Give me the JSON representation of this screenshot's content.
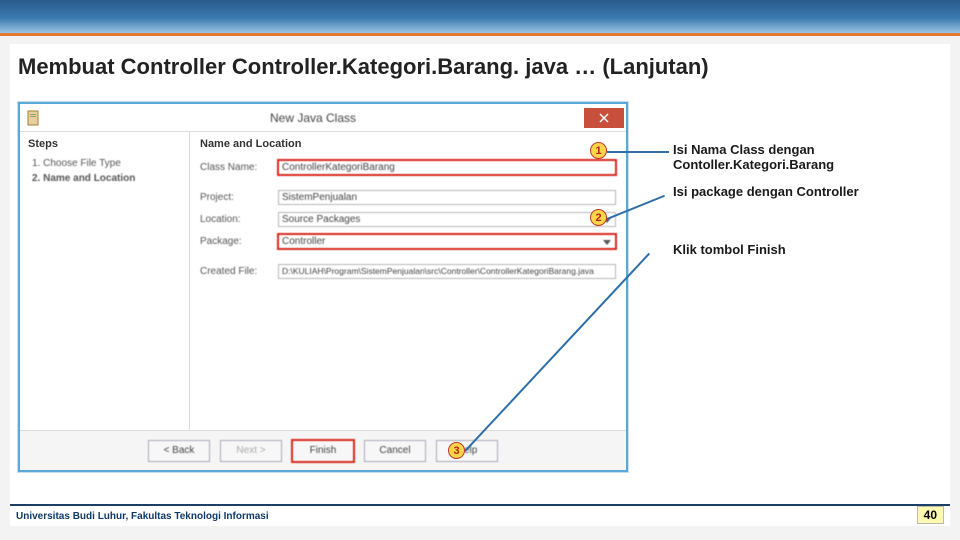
{
  "slide": {
    "title": "Membuat Controller Controller.Kategori.Barang. java … (Lanjutan)"
  },
  "dialog": {
    "title": "New Java Class",
    "steps_header": "Steps",
    "steps": [
      "1.  Choose File Type",
      "2.  Name and Location"
    ],
    "section": "Name and Location",
    "fields": {
      "class_name_label": "Class Name:",
      "class_name_value": "ControllerKategoriBarang",
      "project_label": "Project:",
      "project_value": "SistemPenjualan",
      "location_label": "Location:",
      "location_value": "Source Packages",
      "package_label": "Package:",
      "package_value": "Controller",
      "created_label": "Created File:",
      "created_value": "D:\\KULIAH\\Program\\SistemPenjualan\\src\\Controller\\ControllerKategoriBarang.java"
    },
    "buttons": {
      "back": "< Back",
      "next": "Next >",
      "finish": "Finish",
      "cancel": "Cancel",
      "help": "Help"
    }
  },
  "annotations": {
    "n1": "1",
    "n2": "2",
    "n3": "3",
    "text1": "Isi Nama Class dengan Contoller.Kategori.Barang",
    "text2": "Isi package dengan Controller",
    "text3": "Klik tombol Finish"
  },
  "footer": {
    "university": "Universitas Budi Luhur, Fakultas Teknologi Informasi",
    "page": "40"
  }
}
